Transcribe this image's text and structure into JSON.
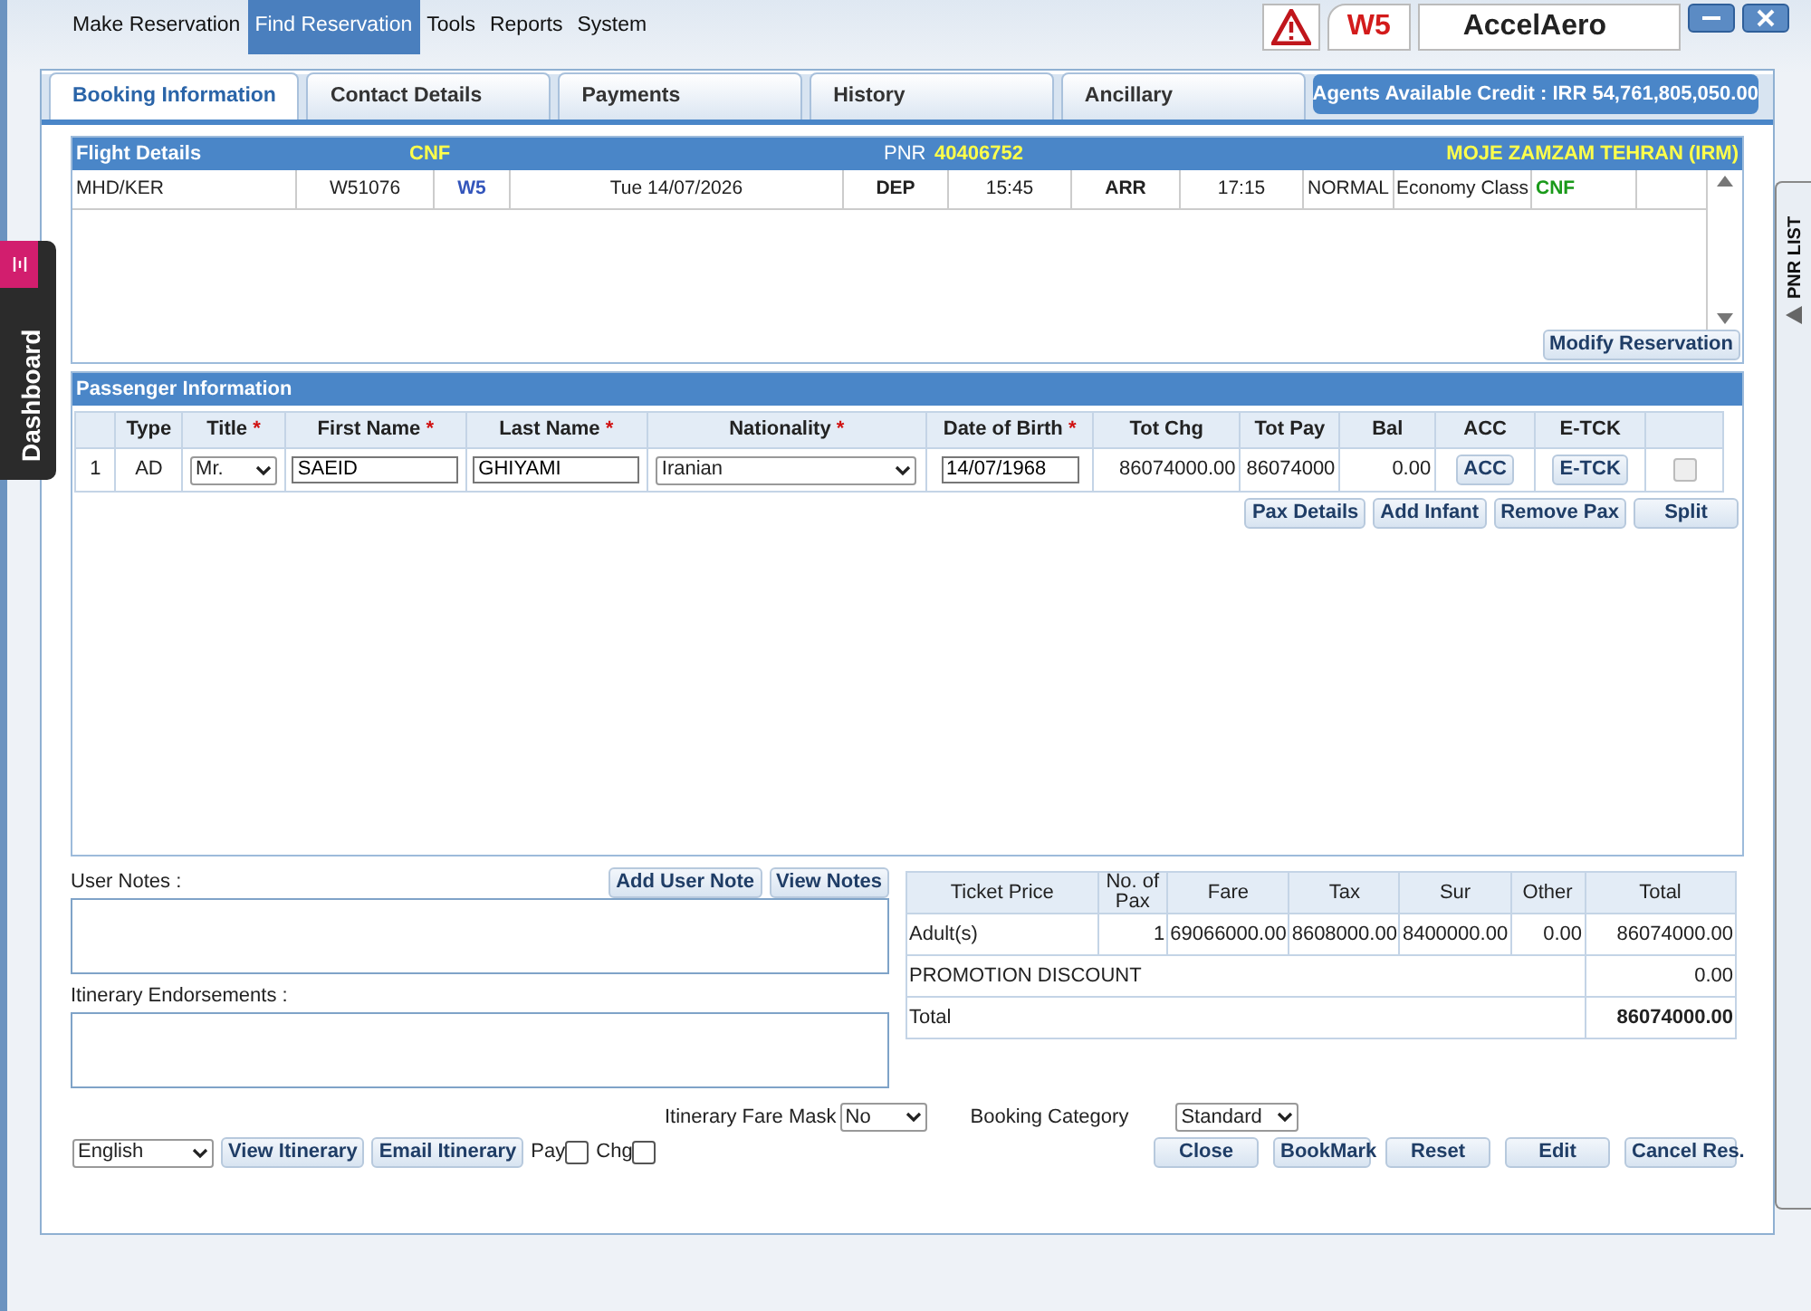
{
  "menu": [
    {
      "label": "Make Reservation",
      "selected": false
    },
    {
      "label": "Find Reservation",
      "selected": true
    },
    {
      "label": "Tools",
      "selected": false
    },
    {
      "label": "Reports",
      "selected": false
    },
    {
      "label": "System",
      "selected": false
    }
  ],
  "brand": {
    "code": "W5",
    "name": "AccelAero"
  },
  "tabs": [
    {
      "label": "Booking Information",
      "selected": true
    },
    {
      "label": "Contact Details",
      "selected": false
    },
    {
      "label": "Payments",
      "selected": false
    },
    {
      "label": "History",
      "selected": false
    },
    {
      "label": "Ancillary",
      "selected": false
    }
  ],
  "credit": "Agents Available Credit : IRR 54,761,805,050.00",
  "flight": {
    "title": "Flight Details",
    "status": "CNF",
    "pnr_label": "PNR",
    "pnr": "40406752",
    "agent": "MOJE ZAMZAM TEHRAN (IRM)",
    "segments": [
      {
        "route": "MHD/KER",
        "flight_no": "W51076",
        "carrier": "W5",
        "date": "Tue 14/07/2026",
        "dep_label": "DEP",
        "dep_time": "15:45",
        "arr_label": "ARR",
        "arr_time": "17:15",
        "fare_type": "NORMAL",
        "cabin": "Economy Class",
        "status": "CNF"
      }
    ],
    "modify_button": "Modify Reservation"
  },
  "passengers": {
    "title": "Passenger Information",
    "required_mark": "*",
    "columns": [
      {
        "label": "Type",
        "required": false
      },
      {
        "label": "Title",
        "required": true
      },
      {
        "label": "First Name",
        "required": true
      },
      {
        "label": "Last Name",
        "required": true
      },
      {
        "label": "Nationality",
        "required": true
      },
      {
        "label": "Date of Birth",
        "required": true
      },
      {
        "label": "Tot Chg",
        "required": false
      },
      {
        "label": "Tot Pay",
        "required": false
      },
      {
        "label": "Bal",
        "required": false
      },
      {
        "label": "ACC",
        "required": false
      },
      {
        "label": "E-TCK",
        "required": false
      }
    ],
    "rows": [
      {
        "no": "1",
        "type": "AD",
        "title": "Mr.",
        "first_name": "SAEID",
        "last_name": "GHIYAMI",
        "nationality": "Iranian",
        "dob": "14/07/1968",
        "tot_chg": "86074000.00",
        "tot_pay": "86074000",
        "bal": "0.00",
        "acc": "ACC",
        "etck": "E-TCK",
        "checked": false,
        "disabled": true
      }
    ],
    "buttons": [
      "Pax Details",
      "Add Infant",
      "Remove Pax",
      "Split"
    ]
  },
  "notes": {
    "user_notes_label": "User Notes :",
    "buttons": [
      "Add User Note",
      "View Notes"
    ],
    "endorsements_label": "Itinerary Endorsements :"
  },
  "price": {
    "columns": [
      "Ticket Price",
      "No. of Pax",
      "Fare",
      "Tax",
      "Sur",
      "Other",
      "Total"
    ],
    "adult": [
      "Adult(s)",
      "1",
      "69066000.00",
      "8608000.00",
      "8400000.00",
      "0.00",
      "86074000.00"
    ],
    "discount": {
      "label": "PROMOTION DISCOUNT",
      "value": "0.00"
    },
    "total": {
      "label": "Total",
      "value": "86074000.00"
    }
  },
  "options": {
    "fare_mask_label": "Itinerary Fare Mask",
    "fare_mask": "No",
    "category_label": "Booking Category",
    "category": "Standard"
  },
  "bottom": {
    "language": "English",
    "left_buttons": [
      "View Itinerary",
      "Email Itinerary"
    ],
    "checks": [
      {
        "label": "Pay",
        "checked": false
      },
      {
        "label": "Chg",
        "checked": false
      }
    ],
    "right_buttons": [
      "Close",
      "BookMark",
      "Reset",
      "Edit",
      "Cancel Res."
    ]
  },
  "side": {
    "dashboard": "Dashboard",
    "pnr_list": "PNR LIST"
  }
}
